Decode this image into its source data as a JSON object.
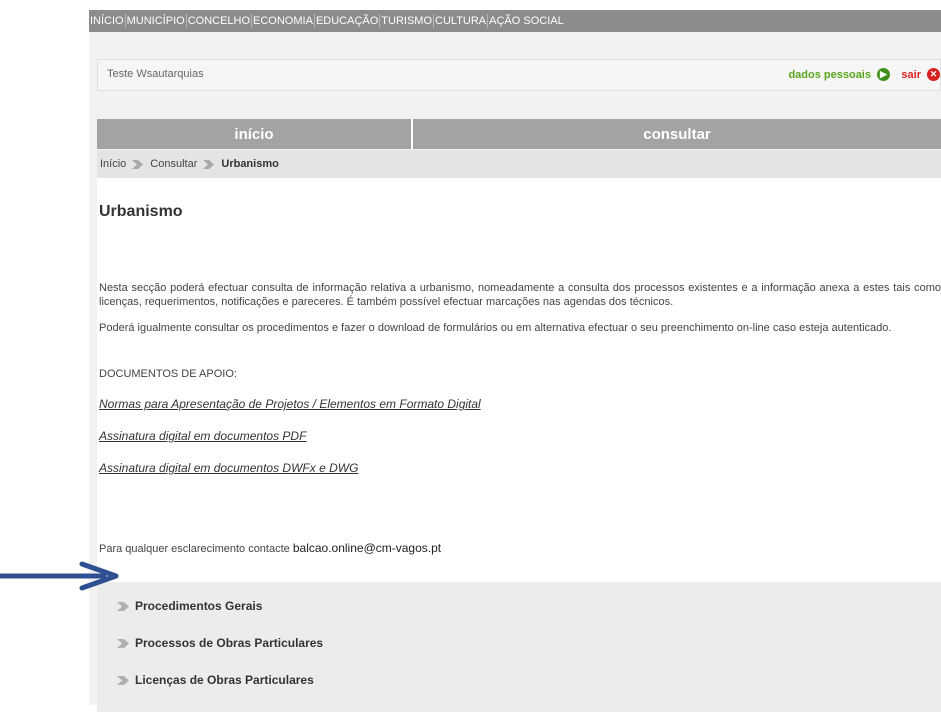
{
  "nav": {
    "items": [
      "INÍCIO",
      "MUNICÍPIO",
      "CONCELHO",
      "ECONOMIA",
      "EDUCAÇÃO",
      "TURISMO",
      "CULTURA",
      "AÇÃO SOCIAL"
    ]
  },
  "user": {
    "name": "Teste Wsautarquias",
    "dados_label": "dados pessoais",
    "sair_label": "sair"
  },
  "tabs": [
    "início",
    "consultar"
  ],
  "breadcrumb": {
    "items": [
      "Início",
      "Consultar",
      "Urbanismo"
    ]
  },
  "page": {
    "title": "Urbanismo",
    "intro": "Nesta secção poderá efectuar consulta de informação relativa a urbanismo, nomeadamente a consulta dos processos existentes e a informação anexa a estes tais como licenças, requerimentos, notificações e pareceres. É também possível efectuar marcações nas agendas dos técnicos.",
    "intro2": "Poderá igualmente consultar os procedimentos e fazer o download de formulários ou em alternativa efectuar o seu preenchimento on-line caso esteja autenticado.",
    "docs_heading": "DOCUMENTOS DE APOIO:",
    "docs": [
      "Normas para Apresentação de Projetos / Elementos em Formato Digital",
      "Assinatura digital em documentos PDF",
      "Assinatura digital em documentos DWFx e DWG"
    ],
    "contact_text": "Para qualquer esclarecimento contacte",
    "contact_email": "balcao.online@cm-vagos.pt"
  },
  "procedures": [
    "Procedimentos Gerais",
    "Processos de Obras Particulares",
    "Licenças de Obras Particulares"
  ],
  "colors": {
    "nav_bg": "#8c8c8c",
    "tab_bg": "#a3a3a3",
    "green": "#5aa51e",
    "red": "#d62222",
    "annotation_arrow": "#2f4f93"
  },
  "icons": {
    "dados": "arrow-right-circle-icon",
    "sair": "close-circle-icon",
    "separator": "chevron-right-icon",
    "annotation": "arrow-right-icon"
  }
}
